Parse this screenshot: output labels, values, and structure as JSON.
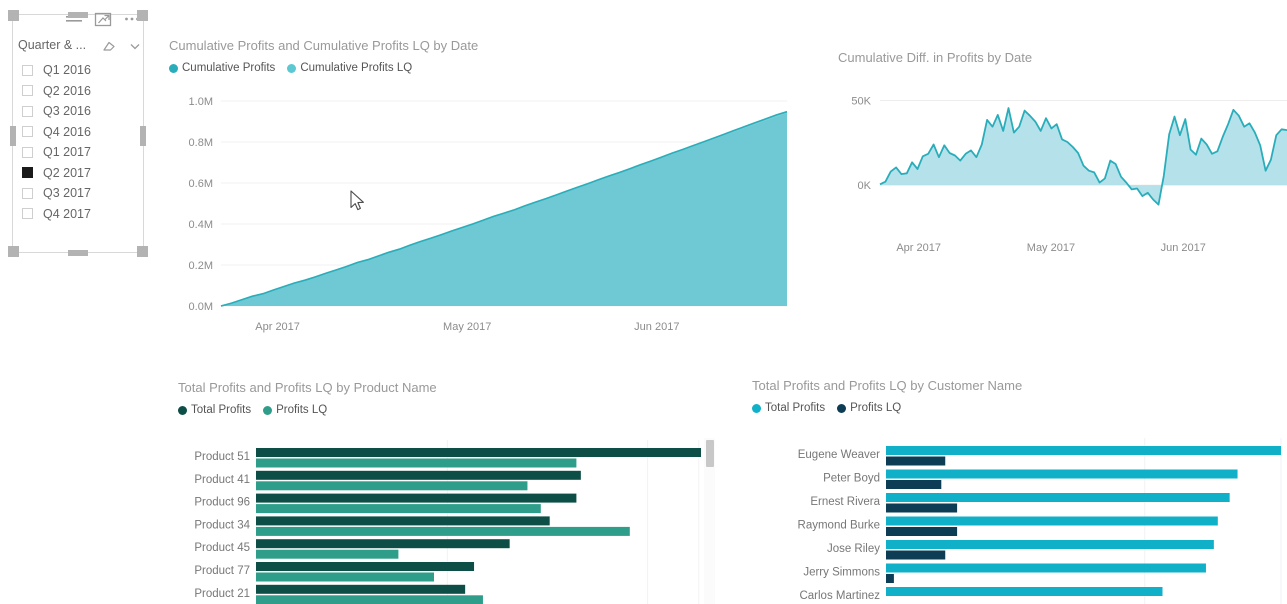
{
  "slicer": {
    "title": "Quarter & ...",
    "toolbar_icons": [
      "filter-list-icon",
      "focus-mode-icon",
      "more-options-icon"
    ],
    "header_icons": [
      "eraser-clear-icon",
      "chevron-down-icon"
    ],
    "items": [
      {
        "label": "Q1 2016",
        "selected": false
      },
      {
        "label": "Q2 2016",
        "selected": false
      },
      {
        "label": "Q3 2016",
        "selected": false
      },
      {
        "label": "Q4 2016",
        "selected": false
      },
      {
        "label": "Q1 2017",
        "selected": false
      },
      {
        "label": "Q2 2017",
        "selected": true
      },
      {
        "label": "Q3 2017",
        "selected": false
      },
      {
        "label": "Q4 2017",
        "selected": false
      }
    ]
  },
  "colors": {
    "cumulative_profits": "#2aadba",
    "cumulative_profits_lq": "#5bc8d2",
    "area_fill": "#6fc9d4",
    "diff_line": "#2aadba",
    "diff_fill": "#a8dde6",
    "total_profits_dark": "#0d4f47",
    "profits_lq_teal": "#2e9e8a",
    "total_profits_cyan": "#0fb0c8",
    "profits_lq_navy": "#0d3c55"
  },
  "chart_data": [
    {
      "type": "area",
      "name": "cumulative-profits-chart",
      "title": "Cumulative Profits and Cumulative Profits LQ by Date",
      "xlabel": "",
      "ylabel": "",
      "ylim": [
        0,
        1000000
      ],
      "ytick_labels": [
        "1.0M",
        "0.8M",
        "0.6M",
        "0.4M",
        "0.2M",
        "0.0M"
      ],
      "xtick_labels": [
        "Apr 2017",
        "May 2017",
        "Jun 2017"
      ],
      "grid": true,
      "legend": [
        {
          "name": "Cumulative Profits",
          "color": "#2aadba"
        },
        {
          "name": "Cumulative Profits LQ",
          "color": "#5bc8d2"
        }
      ],
      "series": [
        {
          "name": "Cumulative Profits",
          "values": [
            0,
            14000,
            31000,
            48000,
            60000,
            78000,
            95000,
            112000,
            126000,
            142000,
            160000,
            176000,
            193000,
            212000,
            226000,
            244000,
            262000,
            277000,
            296000,
            314000,
            330000,
            348000,
            366000,
            383000,
            400000,
            418000,
            437000,
            453000,
            470000,
            489000,
            507000,
            524000,
            542000,
            561000,
            579000,
            597000,
            616000,
            634000,
            651000,
            670000,
            689000,
            707000,
            726000,
            745000,
            763000,
            782000,
            800000,
            819000,
            838000,
            857000,
            876000,
            895000,
            913000,
            932000,
            948000
          ]
        },
        {
          "name": "Cumulative Profits LQ",
          "values": [
            0,
            12000,
            28000,
            45000,
            58000,
            75000,
            92000,
            108000,
            123000,
            139000,
            157000,
            172000,
            190000,
            208000,
            223000,
            240000,
            258000,
            274000,
            292000,
            310000,
            327000,
            344000,
            362000,
            380000,
            397000,
            414000,
            432000,
            449000,
            466000,
            484000,
            502000,
            519000,
            537000,
            555000,
            573000,
            591000,
            609000,
            627000,
            645000,
            663000,
            681000,
            699000,
            717000,
            735000,
            754000,
            772000,
            790000,
            809000,
            827000,
            846000,
            864000,
            882000,
            900000,
            918000,
            935000
          ]
        }
      ]
    },
    {
      "type": "area",
      "name": "cumulative-diff-chart",
      "title": "Cumulative Diff. in Profits by Date",
      "xlabel": "",
      "ylabel": "",
      "ylim": [
        -20000,
        55000
      ],
      "ytick_labels": [
        "50K",
        "0K"
      ],
      "xtick_labels": [
        "Apr 2017",
        "May 2017",
        "Jun 2017"
      ],
      "grid": true,
      "legend": [],
      "series": [
        {
          "name": "Cumulative Diff. in Profits",
          "values": [
            500,
            2000,
            8000,
            10500,
            6500,
            7000,
            13500,
            9500,
            17000,
            18500,
            24000,
            16500,
            23500,
            19000,
            17500,
            14500,
            18500,
            20500,
            16500,
            24000,
            38500,
            34500,
            41500,
            32000,
            45500,
            31000,
            34500,
            44000,
            41000,
            37500,
            32000,
            39500,
            33500,
            36000,
            27000,
            25500,
            22500,
            19000,
            11500,
            8500,
            7500,
            1500,
            4000,
            14500,
            12500,
            5000,
            1500,
            -2500,
            -2000,
            -6500,
            -4500,
            -8500,
            -11500,
            5500,
            30000,
            40500,
            29500,
            39000,
            21000,
            18000,
            27500,
            24000,
            18500,
            20000,
            28500,
            36000,
            44500,
            41000,
            34500,
            36500,
            31000,
            23500,
            8500,
            15000,
            29500,
            33000,
            32500
          ]
        }
      ]
    },
    {
      "type": "bar",
      "orientation": "horizontal",
      "name": "product-profits-chart",
      "title": "Total Profits and Profits LQ by Product Name",
      "categories": [
        "Product 51",
        "Product 41",
        "Product 96",
        "Product 34",
        "Product 45",
        "Product 77",
        "Product 21"
      ],
      "legend": [
        {
          "name": "Total Profits",
          "color": "#0d4f47"
        },
        {
          "name": "Profits LQ",
          "color": "#2e9e8a"
        }
      ],
      "series": [
        {
          "name": "Total Profits",
          "values": [
            100,
            73,
            72,
            66,
            57,
            49,
            47
          ]
        },
        {
          "name": "Profits LQ",
          "values": [
            72,
            61,
            64,
            84,
            32,
            40,
            51
          ]
        }
      ],
      "xlim": [
        0,
        100
      ]
    },
    {
      "type": "bar",
      "orientation": "horizontal",
      "name": "customer-profits-chart",
      "title": "Total Profits and Profits LQ by Customer Name",
      "categories": [
        "Eugene Weaver",
        "Peter Boyd",
        "Ernest Rivera",
        "Raymond Burke",
        "Jose Riley",
        "Jerry Simmons",
        "Carlos Martinez"
      ],
      "legend": [
        {
          "name": "Total Profits",
          "color": "#0fb0c8"
        },
        {
          "name": "Profits LQ",
          "color": "#0d3c55"
        }
      ],
      "series": [
        {
          "name": "Total Profits",
          "values": [
            100,
            89,
            87,
            84,
            83,
            81,
            70
          ]
        },
        {
          "name": "Profits LQ",
          "values": [
            15,
            14,
            18,
            18,
            15,
            2,
            0
          ]
        }
      ],
      "xlim": [
        0,
        100
      ]
    }
  ]
}
